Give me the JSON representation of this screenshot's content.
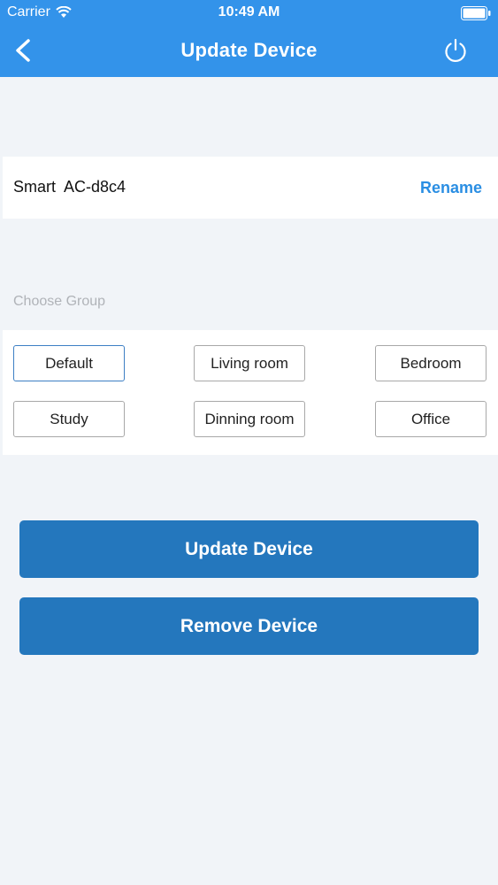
{
  "status_bar": {
    "carrier": "Carrier",
    "time": "10:49 AM"
  },
  "nav": {
    "title": "Update Device",
    "back_icon": "chevron-left-icon",
    "power_icon": "power-icon"
  },
  "device": {
    "name": "Smart  AC-d8c4",
    "rename_label": "Rename"
  },
  "group": {
    "section_label": "Choose Group",
    "options": [
      "Default",
      "Living room",
      "Bedroom",
      "Study",
      "Dinning room",
      "Office"
    ],
    "selected": "Default"
  },
  "actions": {
    "update_label": "Update Device",
    "remove_label": "Remove Device"
  },
  "colors": {
    "header": "#3393ea",
    "accent_text": "#2a8ee3",
    "button": "#2477bd",
    "background": "#f1f4f8"
  }
}
